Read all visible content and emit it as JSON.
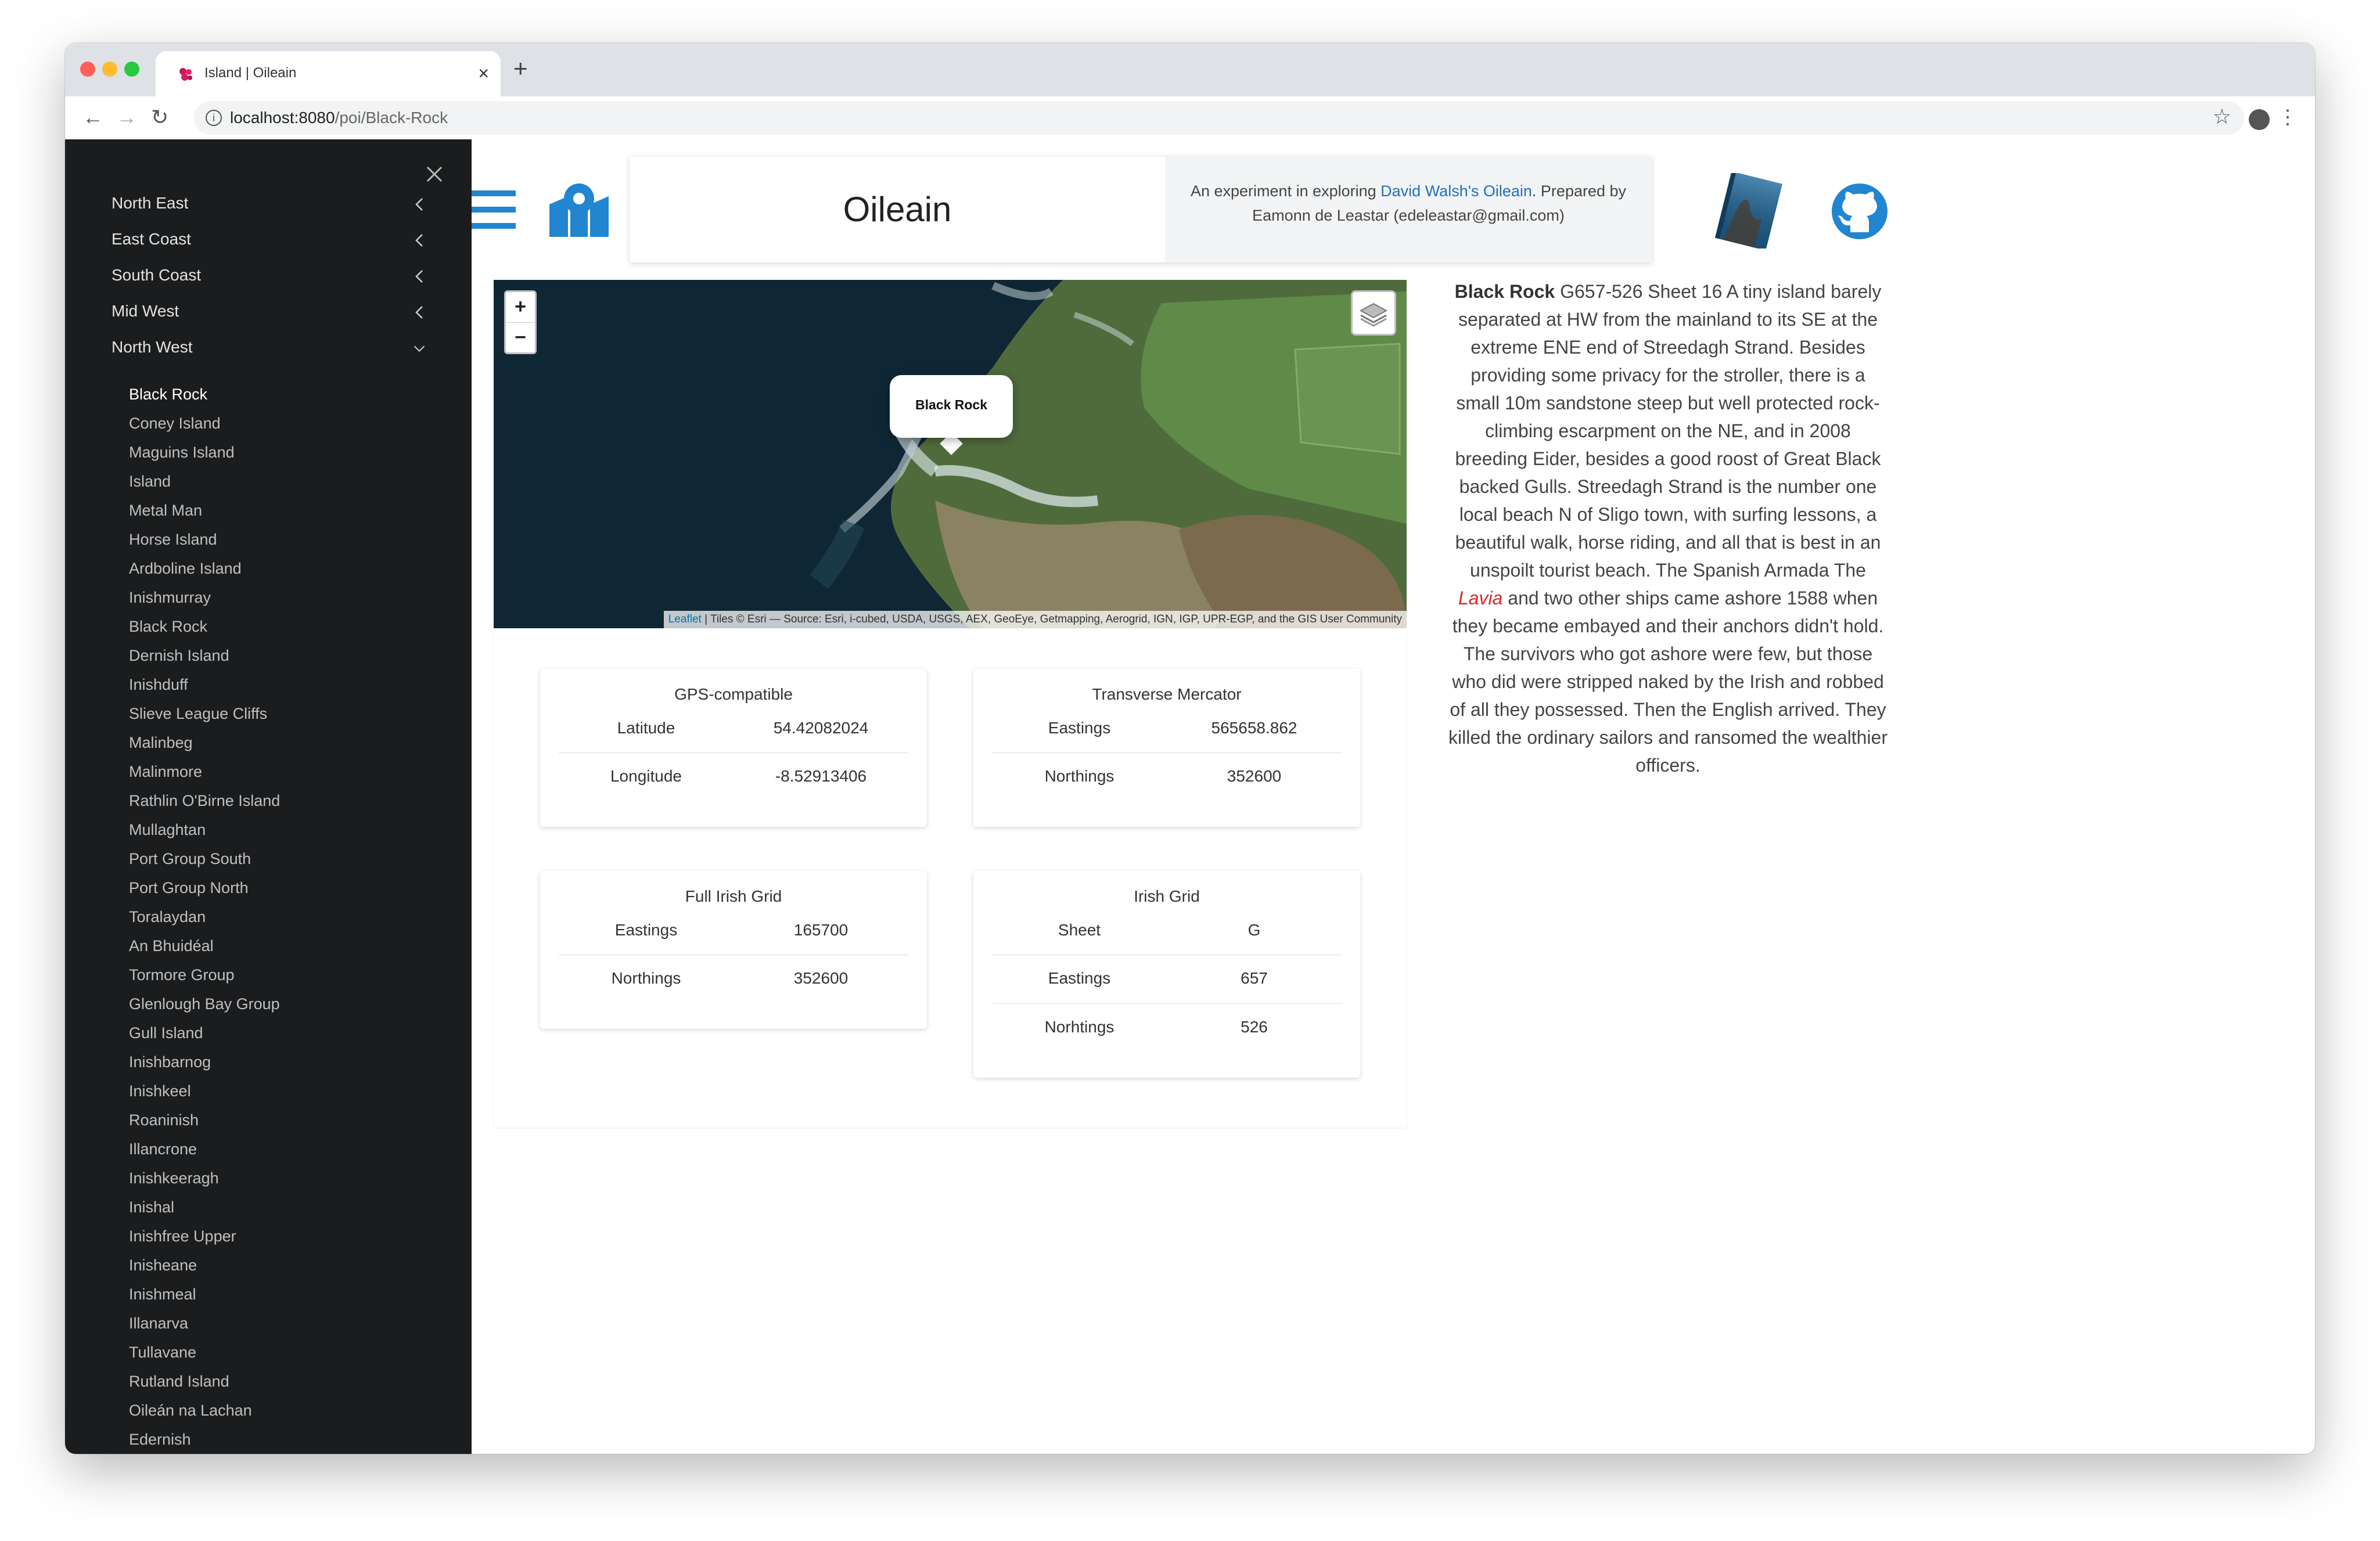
{
  "browser": {
    "tab_title": "Island | Oileain",
    "tab_close": "×",
    "new_tab": "+",
    "url_host": "localhost:8080",
    "url_path": "/poi/Black-Rock",
    "back": "←",
    "forward": "→",
    "reload": "↻",
    "star": "☆",
    "menu": "⋮",
    "info": "i"
  },
  "sidebar": {
    "regions": [
      {
        "label": "North East",
        "state": "collapsed"
      },
      {
        "label": "East Coast",
        "state": "collapsed"
      },
      {
        "label": "South Coast",
        "state": "collapsed"
      },
      {
        "label": "Mid West",
        "state": "collapsed"
      },
      {
        "label": "North West",
        "state": "expanded"
      }
    ],
    "islands": [
      "Black Rock",
      "Coney Island",
      "Maguins Island",
      "Island",
      "Metal Man",
      "Horse Island",
      "Ardboline Island",
      "Inishmurray",
      "Black Rock",
      "Dernish Island",
      "Inishduff",
      "Slieve League Cliffs",
      "Malinbeg",
      "Malinmore",
      "Rathlin O'Birne Island",
      "Mullaghtan",
      "Port Group South",
      "Port Group North",
      "Toralaydan",
      "An Bhuidéal",
      "Tormore Group",
      "Glenlough Bay Group",
      "Gull Island",
      "Inishbarnog",
      "Inishkeel",
      "Roaninish",
      "Illancrone",
      "Inishkeeragh",
      "Inishal",
      "Inishfree Upper",
      "Inisheane",
      "Inishmeal",
      "Illanarva",
      "Tullavane",
      "Rutland Island",
      "Oileán na Lachan",
      "Edernish"
    ],
    "active_island_index": 0
  },
  "header": {
    "site_title": "Oileain",
    "intro_prefix": "An experiment in exploring ",
    "intro_link": "David Walsh's Oileain",
    "intro_suffix": ". Prepared by Eamonn de Leastar (edeleastar@gmail.com)"
  },
  "map": {
    "zoom_in": "+",
    "zoom_out": "−",
    "popup_label": "Black Rock",
    "attribution_link": "Leaflet",
    "attribution_text": " | Tiles © Esri — Source: Esri, i-cubed, USDA, USGS, AEX, GeoEye, Getmapping, Aerogrid, IGN, IGP, UPR-EGP, and the GIS User Community"
  },
  "cards": {
    "gps": {
      "title": "GPS-compatible",
      "rows": [
        {
          "k": "Latitude",
          "v": "54.42082024"
        },
        {
          "k": "Longitude",
          "v": "-8.52913406"
        }
      ]
    },
    "tm": {
      "title": "Transverse Mercator",
      "rows": [
        {
          "k": "Eastings",
          "v": "565658.862"
        },
        {
          "k": "Northings",
          "v": "352600"
        }
      ]
    },
    "fig": {
      "title": "Full Irish Grid",
      "rows": [
        {
          "k": "Eastings",
          "v": "165700"
        },
        {
          "k": "Northings",
          "v": "352600"
        }
      ]
    },
    "ig": {
      "title": "Irish Grid",
      "rows": [
        {
          "k": "Sheet",
          "v": "G"
        },
        {
          "k": "Eastings",
          "v": "657"
        },
        {
          "k": "Norhtings",
          "v": "526"
        }
      ]
    }
  },
  "description": {
    "name": "Black Rock",
    "text_before": " G657-526 Sheet 16 A tiny island barely separated at HW from the mainland to its SE at the extreme ENE end of Streedagh Strand. Besides providing some privacy for the stroller, there is a small 10m sandstone steep but well protected rock-climbing escarpment on the NE, and in 2008 breeding Eider, besides a good roost of Great Black backed Gulls. Streedagh Strand is the number one local beach N of Sligo town, with surfing lessons, a beautiful walk, horse riding, and all that is best in an unspoilt tourist beach. The Spanish Armada The ",
    "ship": "Lavia",
    "text_after": " and two other ships came ashore 1588 when they became embayed and their anchors didn't hold. The survivors who got ashore were few, but those who did were stripped naked by the Irish and robbed of all they possessed. Then the English arrived. They killed the ordinary sailors and ransomed the wealthier officers."
  },
  "colors": {
    "accent": "#2185d0",
    "sidebar_bg": "#1b1c1d",
    "link": "#1e70bf",
    "emphasis": "#db2828"
  }
}
